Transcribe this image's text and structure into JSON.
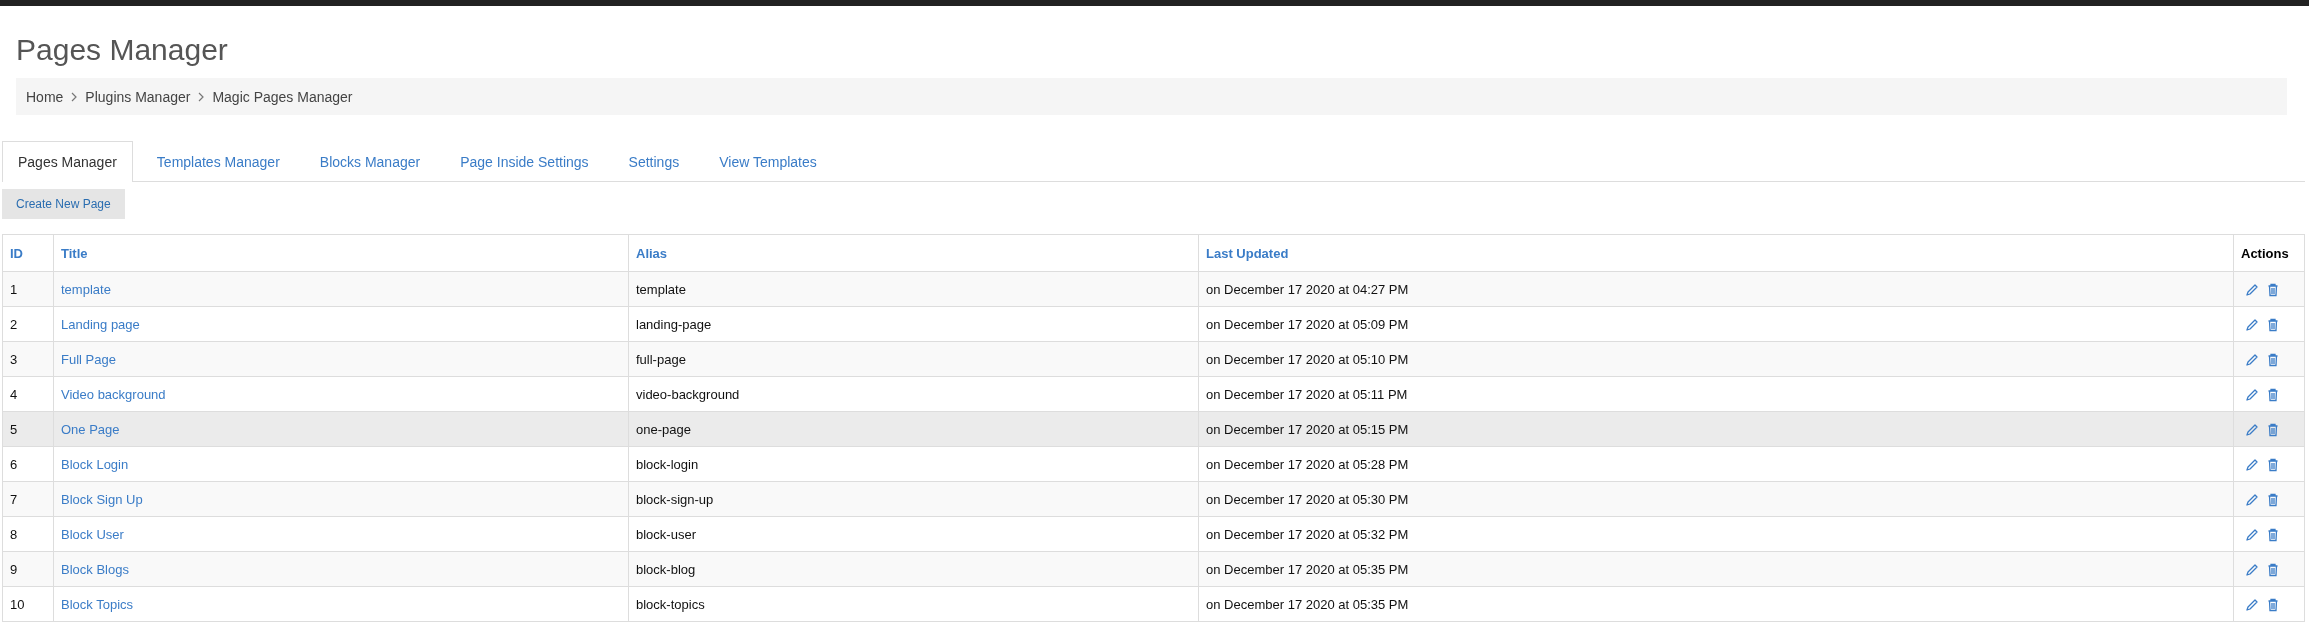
{
  "page_title": "Pages Manager",
  "breadcrumb": [
    "Home",
    "Plugins Manager",
    "Magic Pages Manager"
  ],
  "tabs": [
    {
      "label": "Pages Manager",
      "selected": true
    },
    {
      "label": "Templates Manager",
      "selected": false
    },
    {
      "label": "Blocks Manager",
      "selected": false
    },
    {
      "label": "Page Inside Settings",
      "selected": false
    },
    {
      "label": "Settings",
      "selected": false
    },
    {
      "label": "View Templates",
      "selected": false
    }
  ],
  "create_button": "Create New Page",
  "table": {
    "columns": [
      "ID",
      "Title",
      "Alias",
      "Last Updated",
      "Actions"
    ],
    "rows": [
      {
        "id": "1",
        "title": "template",
        "alias": "template",
        "updated": "on December 17 2020 at 04:27 PM",
        "hovered": false
      },
      {
        "id": "2",
        "title": "Landing page",
        "alias": "landing-page",
        "updated": "on December 17 2020 at 05:09 PM",
        "hovered": false
      },
      {
        "id": "3",
        "title": "Full Page",
        "alias": "full-page",
        "updated": "on December 17 2020 at 05:10 PM",
        "hovered": false
      },
      {
        "id": "4",
        "title": "Video background",
        "alias": "video-background",
        "updated": "on December 17 2020 at 05:11 PM",
        "hovered": false
      },
      {
        "id": "5",
        "title": "One Page",
        "alias": "one-page",
        "updated": "on December 17 2020 at 05:15 PM",
        "hovered": true
      },
      {
        "id": "6",
        "title": "Block Login",
        "alias": "block-login",
        "updated": "on December 17 2020 at 05:28 PM",
        "hovered": false
      },
      {
        "id": "7",
        "title": "Block Sign Up",
        "alias": "block-sign-up",
        "updated": "on December 17 2020 at 05:30 PM",
        "hovered": false
      },
      {
        "id": "8",
        "title": "Block User",
        "alias": "block-user",
        "updated": "on December 17 2020 at 05:32 PM",
        "hovered": false
      },
      {
        "id": "9",
        "title": "Block Blogs",
        "alias": "block-blog",
        "updated": "on December 17 2020 at 05:35 PM",
        "hovered": false
      },
      {
        "id": "10",
        "title": "Block Topics",
        "alias": "block-topics",
        "updated": "on December 17 2020 at 05:35 PM",
        "hovered": false
      }
    ]
  }
}
